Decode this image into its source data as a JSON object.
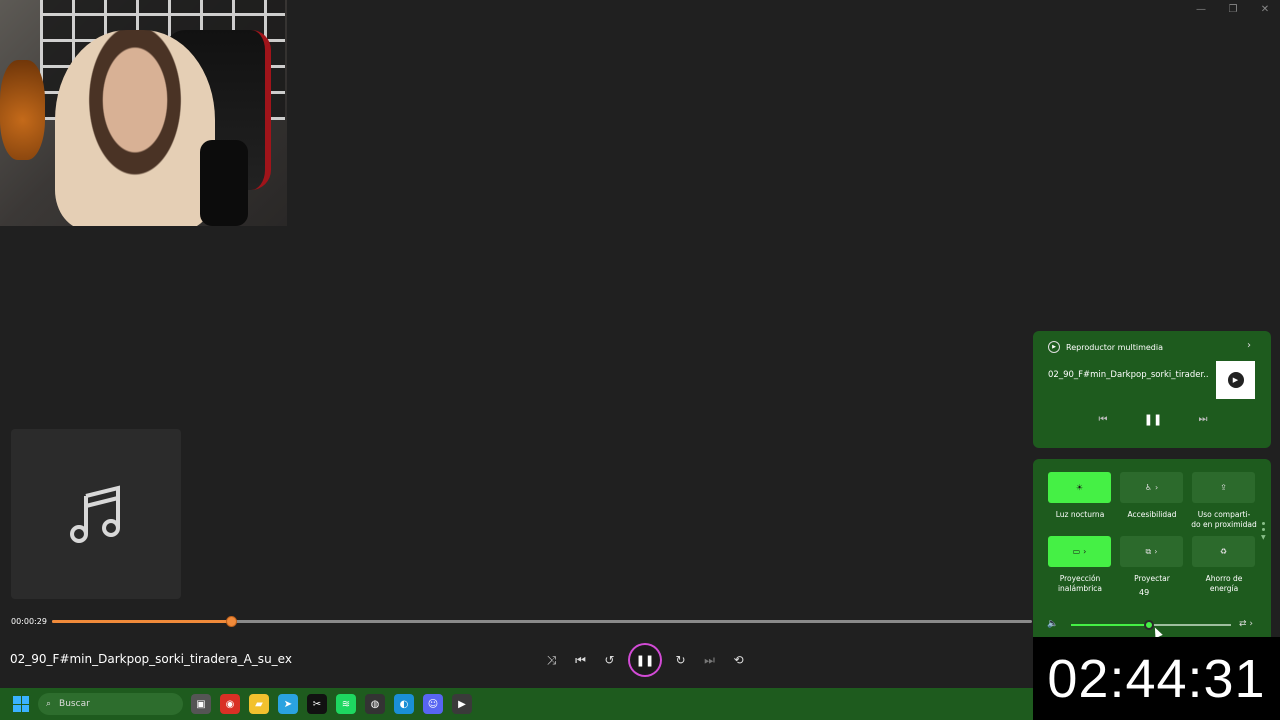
{
  "window_controls": [
    "—",
    "❐",
    "✕"
  ],
  "player": {
    "current_time": "00:00:29",
    "progress": 0.183,
    "track_title": "02_90_F#min_Darkpop_sorki_tiradera_A_su_ex",
    "controls": {
      "shuffle": "⤨",
      "previous": "⏮",
      "rewind": "↺",
      "play_pause": "❚❚",
      "forward": "↻",
      "next": "⏭",
      "repeat": "⟲"
    }
  },
  "media_flyout": {
    "app_name": "Reproductor multimedia",
    "track_title": "02_90_F#min_Darkpop_sorki_tirader...",
    "controls": {
      "previous": "⏮",
      "pause": "❚❚",
      "next": "⏭"
    }
  },
  "quick_settings": {
    "tiles": [
      {
        "label": "Luz nocturna",
        "state": "on",
        "icon": "☀",
        "chevron": ""
      },
      {
        "label": "Accesibilidad",
        "state": "off",
        "icon": "♿",
        "chevron": "›"
      },
      {
        "label": "Uso comparti-\ndo en proximidad",
        "state": "off",
        "icon": "⇪",
        "chevron": ""
      },
      {
        "label": "Proyección\ninalámbrica",
        "state": "on",
        "icon": "▭",
        "chevron": "›"
      },
      {
        "label": "Proyectar",
        "state": "off",
        "icon": "⧉",
        "chevron": "›"
      },
      {
        "label": "Ahorro de\nenergía",
        "state": "off",
        "icon": "♻",
        "chevron": ""
      }
    ],
    "volume": {
      "value": 49,
      "tooltip": "49",
      "icon": "🔈",
      "output_icon": "⇄ ›"
    }
  },
  "clock": "02:44:31",
  "taskbar": {
    "search_placeholder": "Buscar",
    "apps": [
      {
        "name": "task-view",
        "glyph": "▣",
        "color": "#555555"
      },
      {
        "name": "chrome",
        "glyph": "◉",
        "color": "#d93025"
      },
      {
        "name": "file-explorer",
        "glyph": "▰",
        "color": "#f2c12e"
      },
      {
        "name": "telegram",
        "glyph": "➤",
        "color": "#2aa3e0"
      },
      {
        "name": "capcut",
        "glyph": "✂",
        "color": "#111111"
      },
      {
        "name": "spotify",
        "glyph": "≋",
        "color": "#1ed760"
      },
      {
        "name": "obs",
        "glyph": "◍",
        "color": "#333333"
      },
      {
        "name": "edge",
        "glyph": "◐",
        "color": "#1a8fd6"
      },
      {
        "name": "discord",
        "glyph": "☺",
        "color": "#5865f2"
      },
      {
        "name": "media-player",
        "glyph": "▶",
        "color": "#3a3a3a"
      }
    ]
  }
}
